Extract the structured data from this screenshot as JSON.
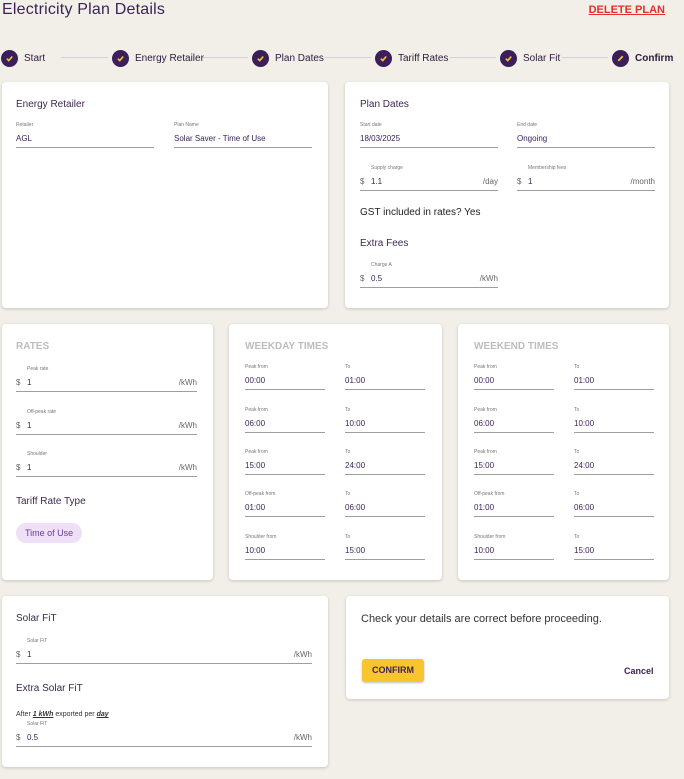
{
  "header": {
    "title": "Electricity Plan Details",
    "delete_label": "DELETE PLAN"
  },
  "stepper": {
    "steps": [
      {
        "label": "Start",
        "state": "complete",
        "icon": "check-icon"
      },
      {
        "label": "Energy Retailer",
        "state": "complete",
        "icon": "check-icon"
      },
      {
        "label": "Plan Dates",
        "state": "complete",
        "icon": "check-icon"
      },
      {
        "label": "Tariff Rates",
        "state": "complete",
        "icon": "check-icon"
      },
      {
        "label": "Solar Fit",
        "state": "complete",
        "icon": "check-icon"
      },
      {
        "label": "Confirm",
        "state": "active",
        "icon": "pencil-icon"
      }
    ]
  },
  "retailer": {
    "title": "Energy Retailer",
    "retailer_label": "Retailer",
    "retailer_value": "AGL",
    "plan_label": "Plan Name",
    "plan_value": "Solar Saver - Time of Use"
  },
  "plan_dates": {
    "title": "Plan Dates",
    "start_label": "Start date",
    "start_value": "18/03/2025",
    "end_label": "End date",
    "end_value": "Ongoing",
    "supply_label": "Supply charge",
    "supply_value": "1.1",
    "supply_unit": "/day",
    "membership_label": "Membership fees",
    "membership_value": "1",
    "membership_unit": "/month",
    "currency": "$",
    "gst_text": "GST included in rates? Yes",
    "extra_title": "Extra Fees",
    "charge_label": "Charge A",
    "charge_value": "0.5",
    "charge_unit": "/kWh"
  },
  "rates": {
    "title": "RATES",
    "currency": "$",
    "unit": "/kWh",
    "peak_label": "Peak rate",
    "peak_value": "1",
    "offpeak_label": "Off-peak rate",
    "offpeak_value": "1",
    "shoulder_label": "Shoulder",
    "shoulder_value": "1",
    "tariff_title": "Tariff Rate Type",
    "tariff_chip": "Time of Use"
  },
  "weekday": {
    "title": "WEEKDAY TIMES",
    "rows": [
      {
        "from_label": "Peak from",
        "from": "00:00",
        "to_label": "To",
        "to": "01:00"
      },
      {
        "from_label": "Peak from",
        "from": "06:00",
        "to_label": "To",
        "to": "10:00"
      },
      {
        "from_label": "Peak from",
        "from": "15:00",
        "to_label": "To",
        "to": "24:00"
      },
      {
        "from_label": "Off-peak from",
        "from": "01:00",
        "to_label": "To",
        "to": "06:00"
      },
      {
        "from_label": "Shoulder from",
        "from": "10:00",
        "to_label": "To",
        "to": "15:00"
      }
    ]
  },
  "weekend": {
    "title": "WEEKEND TIMES",
    "rows": [
      {
        "from_label": "Peak from",
        "from": "00:00",
        "to_label": "To",
        "to": "01:00"
      },
      {
        "from_label": "Peak from",
        "from": "06:00",
        "to_label": "To",
        "to": "10:00"
      },
      {
        "from_label": "Peak from",
        "from": "15:00",
        "to_label": "To",
        "to": "24:00"
      },
      {
        "from_label": "Off-peak from",
        "from": "01:00",
        "to_label": "To",
        "to": "06:00"
      },
      {
        "from_label": "Shoulder from",
        "from": "10:00",
        "to_label": "To",
        "to": "15:00"
      }
    ]
  },
  "solar": {
    "title": "Solar FiT",
    "fit_label": "Solar FiT",
    "fit_value": "1",
    "currency": "$",
    "unit": "/kWh",
    "extra_title": "Extra Solar FiT",
    "note_prefix": "After",
    "note_amount": "1 kWh",
    "note_middle": "exported per",
    "note_period": "day",
    "extra_label": "Solar FiT",
    "extra_value": "0.5"
  },
  "confirm": {
    "message": "Check your details are correct before proceeding.",
    "confirm_label": "CONFIRM",
    "cancel_label": "Cancel"
  }
}
